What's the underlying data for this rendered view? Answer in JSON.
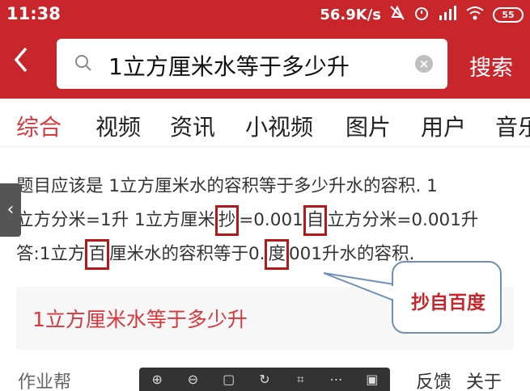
{
  "status": {
    "time": "11:38",
    "speed": "56.9K/s",
    "battery": "55"
  },
  "search": {
    "query": "1立方厘米水等于多少升",
    "button": "搜索"
  },
  "tabs": [
    "综合",
    "视频",
    "资讯",
    "小视频",
    "图片",
    "用户",
    "音乐"
  ],
  "answer": {
    "line1": "题目应该是 1立方厘米水的容积等于多少升水的容积. 1",
    "line2_a": "立方分米=1升 1立方厘米",
    "line2_b": "抄",
    "line2_c": "=0.001",
    "line2_d": "自",
    "line2_e": "立方分米=0.001升",
    "line3_a": "答:1立方",
    "line3_b": "百",
    "line3_c": "厘米水的容积等于0.",
    "line3_d": "度",
    "line3_e": "001升水的容积."
  },
  "callout": "抄自百度",
  "related_card": "1立方厘米水等于多少升",
  "source": "作业帮",
  "footer_links": [
    "反馈",
    "关于"
  ],
  "colors": {
    "brand_red": "#c8262b",
    "tab_active": "#d9383c",
    "highlight_box": "#b41818",
    "callout_border": "#6e8fb6"
  }
}
